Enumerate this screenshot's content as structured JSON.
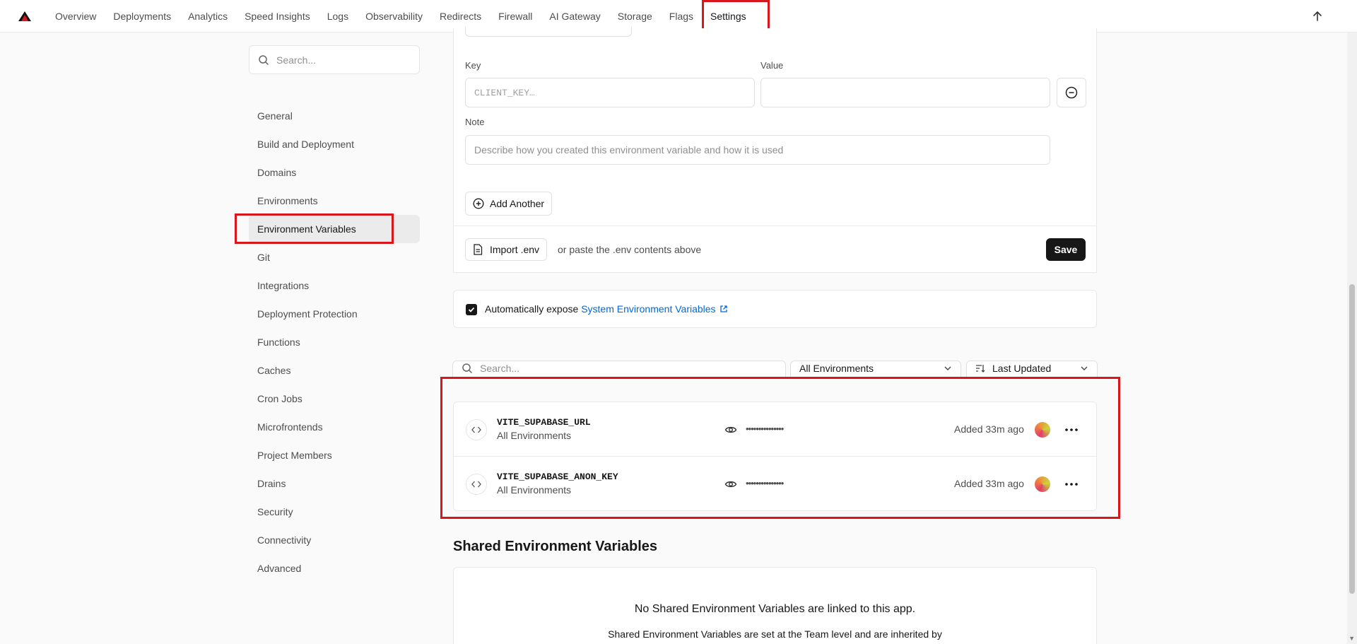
{
  "nav": {
    "items": [
      "Overview",
      "Deployments",
      "Analytics",
      "Speed Insights",
      "Logs",
      "Observability",
      "Redirects",
      "Firewall",
      "AI Gateway",
      "Storage",
      "Flags"
    ],
    "settings": "Settings"
  },
  "sidebar": {
    "search_placeholder": "Search...",
    "items": [
      "General",
      "Build and Deployment",
      "Domains",
      "Environments",
      "Environment Variables",
      "Git",
      "Integrations",
      "Deployment Protection",
      "Functions",
      "Caches",
      "Cron Jobs",
      "Microfrontends",
      "Project Members",
      "Drains",
      "Security",
      "Connectivity",
      "Advanced"
    ],
    "active": "Environment Variables"
  },
  "form": {
    "key_label": "Key",
    "value_label": "Value",
    "key_placeholder": "CLIENT_KEY…",
    "value_placeholder": "",
    "note_label": "Note",
    "note_placeholder": "Describe how you created this environment variable and how it is used",
    "add_another": "Add Another",
    "import_env": "Import .env",
    "paste_hint": "or paste the .env contents above",
    "save": "Save"
  },
  "expose": {
    "checked": true,
    "label": "Automatically expose",
    "link": "System Environment Variables"
  },
  "filters": {
    "search_placeholder": "Search...",
    "environment": "All Environments",
    "sort": "Last Updated"
  },
  "env_vars": [
    {
      "name": "VITE_SUPABASE_URL",
      "scope": "All Environments",
      "masked": "•••••••••••••••",
      "added": "Added 33m ago"
    },
    {
      "name": "VITE_SUPABASE_ANON_KEY",
      "scope": "All Environments",
      "masked": "•••••••••••••••",
      "added": "Added 33m ago"
    }
  ],
  "shared": {
    "title": "Shared Environment Variables",
    "empty": "No Shared Environment Variables are linked to this app.",
    "desc": "Shared Environment Variables are set at the Team level and are inherited by"
  },
  "colors": {
    "highlight": "#d9161c",
    "link": "#0068d6",
    "dark": "#171717"
  }
}
